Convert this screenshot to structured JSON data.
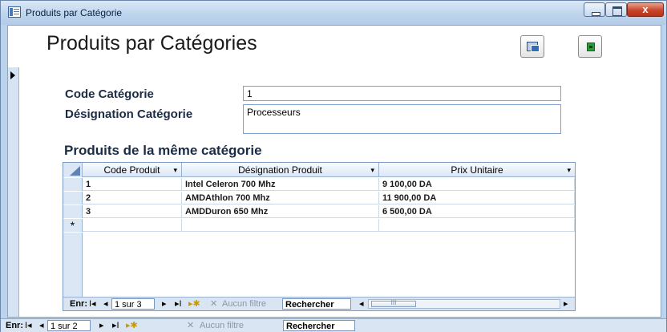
{
  "window": {
    "title": "Produits par Catégorie",
    "close_glyph": "x",
    "colors": {
      "titlebar": "#bfd5ee",
      "close_button": "#c8452a",
      "frame": "#bcd3ec"
    }
  },
  "form": {
    "title": "Produits par Catégories",
    "header_buttons": [
      {
        "icon": "form-icon"
      },
      {
        "icon": "exit-icon"
      }
    ]
  },
  "fields": {
    "code": {
      "label": "Code Catégorie",
      "value": "1"
    },
    "designation": {
      "label": "Désignation Catégorie",
      "value": "Processeurs"
    }
  },
  "subform": {
    "title": "Produits de la même catégorie",
    "columns": [
      "Code Produit",
      "Désignation Produit",
      "Prix Unitaire"
    ],
    "rows": [
      {
        "code": "1",
        "designation": "Intel Celeron 700 Mhz",
        "prix": "9 100,00  DA"
      },
      {
        "code": "2",
        "designation": "AMDAthlon 700 Mhz",
        "prix": "11 900,00  DA"
      },
      {
        "code": "3",
        "designation": "AMDDuron 650 Mhz",
        "prix": "6 500,00  DA"
      }
    ],
    "new_row_marker": "*",
    "navigator": {
      "label": "Enr:",
      "position": "1 sur 3",
      "filter": "Aucun filtre",
      "search": "Rechercher",
      "scroll_glyph": "III"
    }
  },
  "main_navigator": {
    "label": "Enr:",
    "position": "1 sur 2",
    "filter": "Aucun filtre",
    "search": "Rechercher"
  }
}
